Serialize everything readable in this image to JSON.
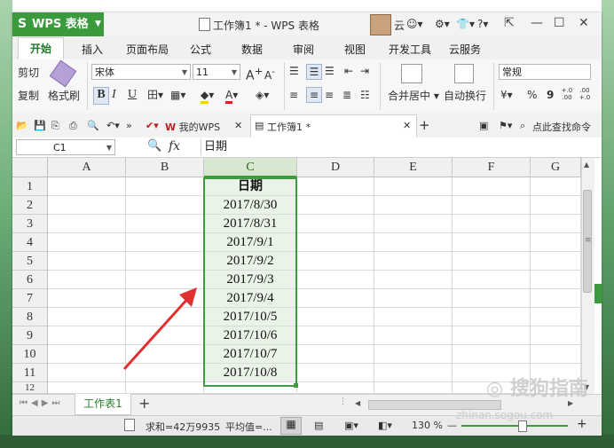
{
  "app": {
    "name": "WPS 表格",
    "logo_glyph": "S",
    "document_title": "工作簿1 * - WPS 表格",
    "user_label": "云",
    "help_label": "?"
  },
  "ribbon_tabs": [
    "开始",
    "插入",
    "页面布局",
    "公式",
    "数据",
    "审阅",
    "视图",
    "开发工具",
    "云服务"
  ],
  "ribbon": {
    "cut_label": "剪切",
    "copy_label": "复制",
    "format_painter_label": "格式刷",
    "font_name": "宋体",
    "font_size": "11",
    "bold": "B",
    "italic": "I",
    "underline": "U",
    "merge_center_label": "合并居中",
    "wrap_text_label": "自动换行",
    "number_format": "常规",
    "percent": "%",
    "comma": "9",
    "inc_decimal": "+.0 .00",
    "dec_decimal": ".00 +.0",
    "grow_font": "A",
    "shrink_font": "A"
  },
  "doc_tabs": {
    "my_wps_label": "我的WPS",
    "active_label": "工作簿1 *",
    "search_label": "点此查找命令"
  },
  "formula_bar": {
    "cell_ref": "C1",
    "fx": "fx",
    "content": "日期"
  },
  "sheet": {
    "columns": [
      "A",
      "B",
      "C",
      "D",
      "E",
      "F",
      "G"
    ],
    "selected_column": "C",
    "rows": [
      "1",
      "2",
      "3",
      "4",
      "5",
      "6",
      "7",
      "8",
      "9",
      "10",
      "11",
      "12"
    ],
    "column_c_values": [
      "日期",
      "2017/8/30",
      "2017/8/31",
      "2017/9/1",
      "2017/9/2",
      "2017/9/3",
      "2017/9/4",
      "2017/10/5",
      "2017/10/6",
      "2017/10/7",
      "2017/10/8"
    ]
  },
  "sheet_tabs": {
    "active": "工作表1",
    "add": "+"
  },
  "status": {
    "sum_text": "求和=42万9935",
    "avg_text": "平均值=...",
    "zoom": "130 %",
    "zoom_minus": "—",
    "zoom_plus": "+"
  },
  "watermark": {
    "text": "搜狗指南",
    "url": "zhinan.sogou.com"
  },
  "colors": {
    "accent": "#3a9a3c",
    "selection_fill": "#eaf3e7",
    "arrow": "#e03030"
  }
}
